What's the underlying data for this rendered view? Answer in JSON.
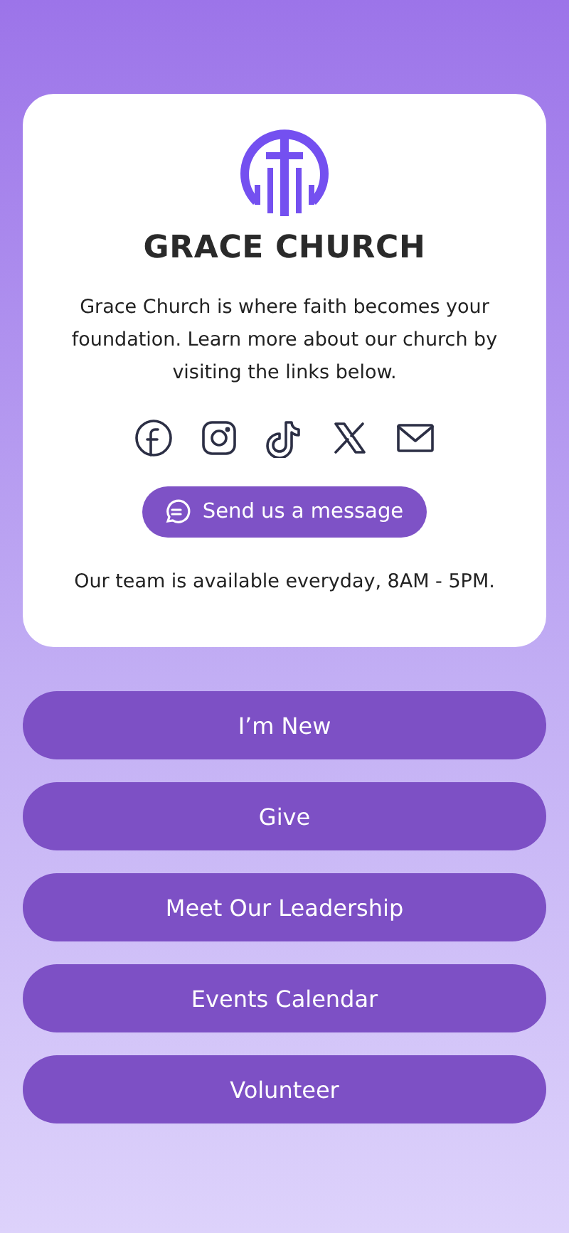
{
  "profile": {
    "name": "GRACE CHURCH",
    "description": "Grace Church is where faith becomes your foundation. Learn more about our church by visiting the links below.",
    "message_button": "Send us a message",
    "hours": "Our team is available everyday, 8AM - 5PM."
  },
  "links": [
    {
      "label": "I’m New"
    },
    {
      "label": "Give"
    },
    {
      "label": "Meet Our Leadership"
    },
    {
      "label": "Events Calendar"
    },
    {
      "label": "Volunteer"
    }
  ]
}
